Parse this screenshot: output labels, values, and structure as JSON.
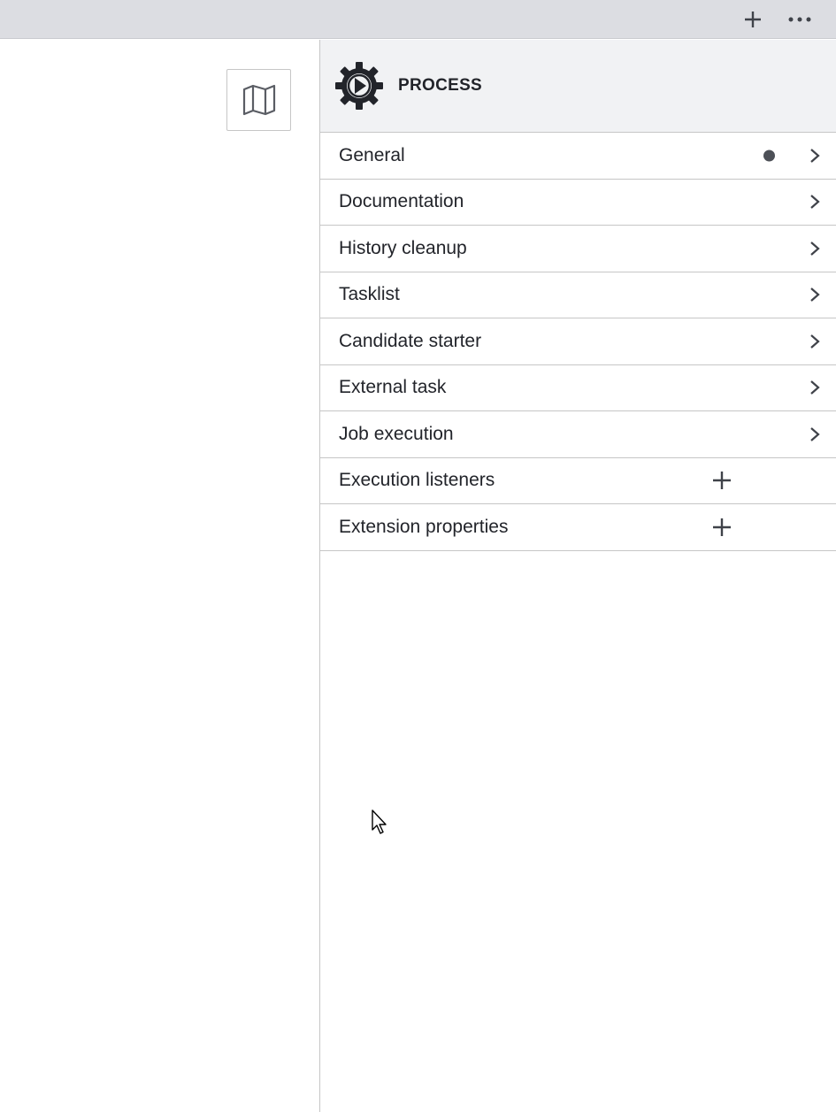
{
  "topbar": {
    "add_icon": "plus-icon",
    "more_icon": "ellipsis-icon"
  },
  "canvas": {
    "map_icon": "map-icon"
  },
  "panel": {
    "header": {
      "icon": "process-gear-play-icon",
      "title": "PROCESS"
    },
    "groups": [
      {
        "label": "General",
        "indicator": "dot",
        "action": "chevron-right-icon"
      },
      {
        "label": "Documentation",
        "action": "chevron-right-icon"
      },
      {
        "label": "History cleanup",
        "action": "chevron-right-icon"
      },
      {
        "label": "Tasklist",
        "action": "chevron-right-icon"
      },
      {
        "label": "Candidate starter",
        "action": "chevron-right-icon"
      },
      {
        "label": "External task",
        "action": "chevron-right-icon"
      },
      {
        "label": "Job execution",
        "action": "chevron-right-icon"
      },
      {
        "label": "Execution listeners",
        "action": "plus-icon"
      },
      {
        "label": "Extension properties",
        "action": "plus-icon"
      }
    ]
  },
  "colors": {
    "topbar_bg": "#dcdde2",
    "header_bg": "#f1f2f4",
    "text": "#22242a",
    "border": "#c6c6c6",
    "icon": "#4d5057"
  }
}
